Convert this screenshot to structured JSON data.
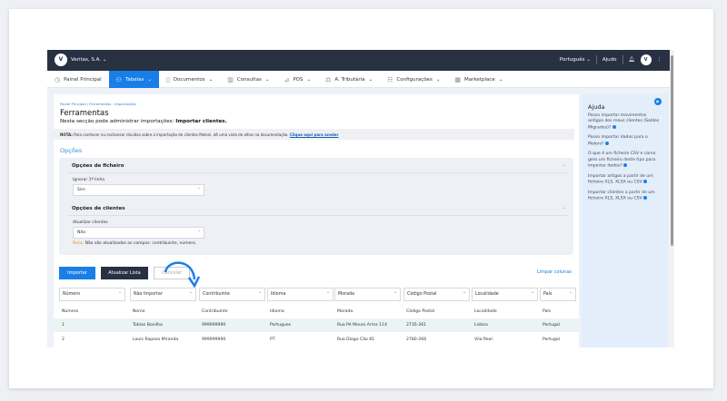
{
  "topbar": {
    "company": "Veritas, S.A.",
    "language": "Português",
    "help": "Ajudo",
    "avatar_initials": "V"
  },
  "nav": [
    {
      "label": "Painel Principal",
      "icon": "dashboard-icon"
    },
    {
      "label": "Tabelas",
      "icon": "users-icon",
      "active": true
    },
    {
      "label": "Documentos",
      "icon": "document-icon"
    },
    {
      "label": "Consultas",
      "icon": "chart-icon"
    },
    {
      "label": "POS",
      "icon": "pos-icon"
    },
    {
      "label": "A. Tributária",
      "icon": "tax-icon"
    },
    {
      "label": "Configurações",
      "icon": "settings-icon"
    },
    {
      "label": "Marketplace",
      "icon": "grid-icon"
    }
  ],
  "breadcrumb": {
    "home": "Painel Principal",
    "current": "Ferramentas - Importações"
  },
  "title": "Ferramentas",
  "subtitle": {
    "text": "Nesta secção pode administrar importações: ",
    "bold": "Importar clientes."
  },
  "note": {
    "label": "NOTA:",
    "text": " Para conhecer ou esclarecer dúvidas sobre a importação de clientes Moloni, dê uma vista de olhos na documentação. ",
    "link": "Clique aqui para aceder"
  },
  "options": {
    "title": "Opções",
    "file": {
      "title": "Opções de ficheiro",
      "field_label": "Ignorar 1ª linha",
      "value": "Sim"
    },
    "clients": {
      "title": "Opções de clientes",
      "field_label": "Atualizar clientes",
      "value": "Não",
      "warn_label": "Nota:",
      "warn_text": " Não são atualizados os campos: contribuinte, número."
    }
  },
  "buttons": {
    "import": "Importar",
    "refresh": "Atualizar Lista",
    "cancel": "Cancelar",
    "clear_columns": "Limpar colunas"
  },
  "column_selects": [
    "Número",
    "Não Importar",
    "Contribuinte",
    "Idioma",
    "Morada",
    "Código Postal",
    "Localidade",
    "País"
  ],
  "table": {
    "headers": [
      "Número",
      "Nome",
      "Contribuinte",
      "Idioma",
      "Morada",
      "Código Postal",
      "Localidade",
      "País"
    ],
    "rows": [
      [
        "1",
        "Tobias Bonilha",
        "999999990",
        "Portugues",
        "Rua Pé Mouro Armz 114",
        "2735-261",
        "Lisboa",
        "Portugal"
      ],
      [
        "2",
        "Louis Raposo Miranda",
        "999999990",
        "PT",
        "Rua Diogo Cão 81",
        "2780-266",
        "Vila Real",
        "Portugal"
      ]
    ]
  },
  "help": {
    "title": "Ajuda",
    "items": [
      "Posso importar movimentos antigos dos meus clientes (Saldos Migrados)?",
      "Posso importar dados para o Moloni?",
      "O que é um ficheiro CSV e como gero um ficheiro deste tipo para importar dados?",
      "Importar artigos a partir de um ficheiro XLS, XLSX ou CSV",
      "Importar clientes a partir de um ficheiro XLS, XLSX ou CSV"
    ]
  },
  "colors": {
    "accent": "#1a7ee8",
    "topbar": "#273142"
  }
}
